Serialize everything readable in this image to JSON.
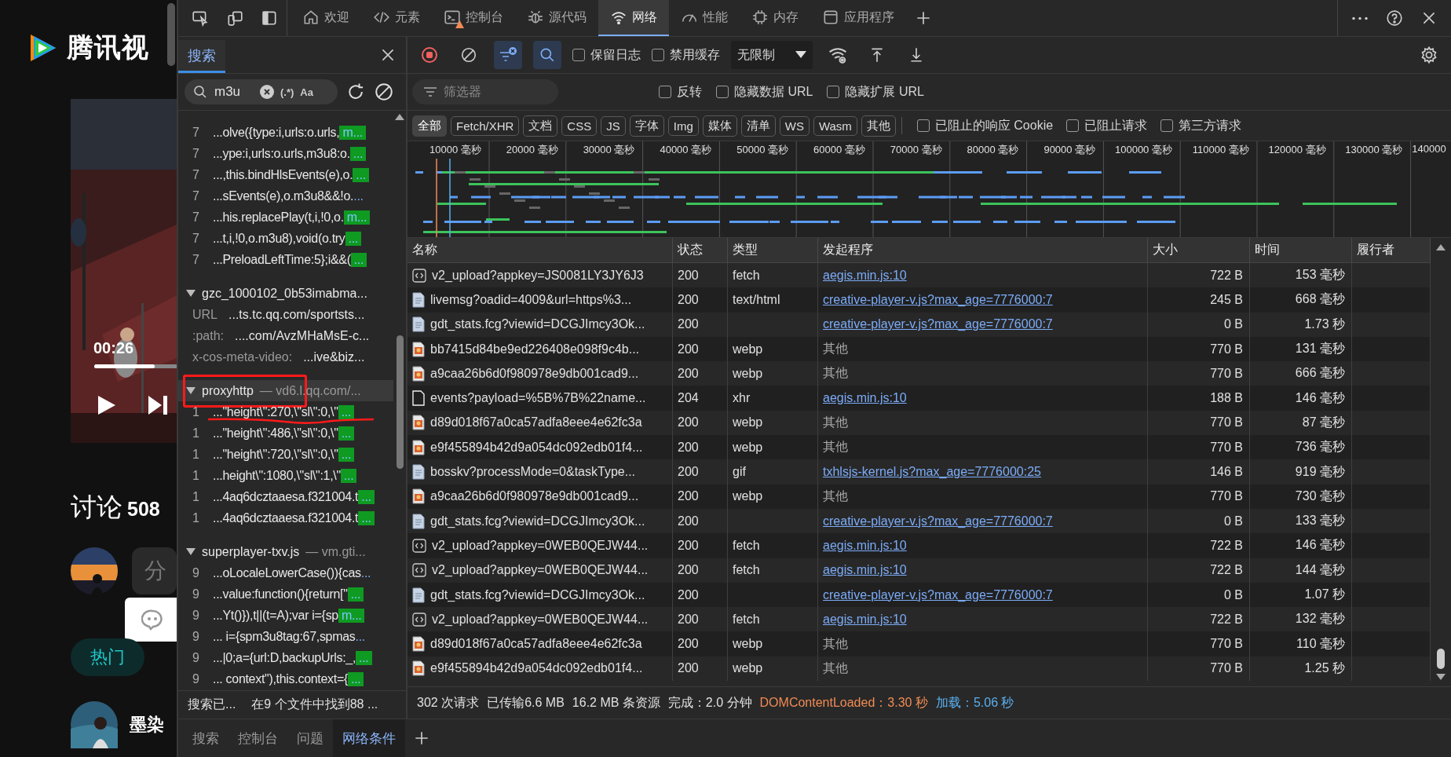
{
  "webpage": {
    "logo_text": "腾讯视",
    "video": {
      "time": "00:26",
      "level": 0.7
    },
    "discussion": {
      "label": "讨论",
      "count": "508"
    },
    "comment_preview": "分",
    "hot_tab": "热门",
    "user_name": "墨染"
  },
  "devtools": {
    "tabs": [
      {
        "label": "欢迎",
        "selected": false,
        "warning": false
      },
      {
        "label": "元素",
        "selected": false,
        "warning": false
      },
      {
        "label": "控制台",
        "selected": false,
        "warning": true
      },
      {
        "label": "源代码",
        "selected": false,
        "warning": false
      },
      {
        "label": "网络",
        "selected": true,
        "warning": false
      },
      {
        "label": "性能",
        "selected": false,
        "warning": false
      },
      {
        "label": "内存",
        "selected": false,
        "warning": false
      },
      {
        "label": "应用程序",
        "selected": false,
        "warning": false
      }
    ]
  },
  "search_panel": {
    "tab": {
      "label": "搜索",
      "selected": true
    },
    "query": "m3u",
    "regex_toggle": "(.*)",
    "case_toggle": "Aa",
    "groups": [
      {
        "kind": "lines",
        "lines": [
          {
            "num": "7",
            "text": "...olve({type:i,urls:o.urls,",
            "match": "m...",
            "highlight": true
          },
          {
            "num": "7",
            "text": "...ype:i,urls:o.urls,m3u8:o.",
            "match": "...",
            "highlight": true
          },
          {
            "num": "7",
            "text": "...,this.bindHlsEvents(e),o.",
            "match": "...",
            "highlight": true
          },
          {
            "num": "7",
            "text": "...sEvents(e),o.m3u8&&!o.",
            "match": "...",
            "highlight": false
          },
          {
            "num": "7",
            "text": "...his.replacePlay(t,i,!0,o.",
            "match": "m...",
            "highlight": true
          },
          {
            "num": "7",
            "text": "...t,i,!0,o.m3u8),void(o.try",
            "match": "...",
            "highlight": true
          },
          {
            "num": "7",
            "text": "...PreloadLeftTime:5};i&&(",
            "match": "...",
            "highlight": true
          }
        ]
      },
      {
        "kind": "headers",
        "name": "gzc_1000102_0b53imabma...",
        "selected": false,
        "lines": [
          {
            "key": "URL",
            "value": "...ts.tc.qq.com/sportsts..."
          },
          {
            "key": ":path:",
            "value": "....com/AvzMHaMsE-c..."
          },
          {
            "key": "x-cos-meta-video:",
            "value": "...ive&biz..."
          }
        ]
      },
      {
        "kind": "lines",
        "name": "proxyhttp",
        "source": "— vd6.l.qq.com/...",
        "selected": true,
        "lines": [
          {
            "num": "1",
            "text": "...\"height\\\":270,\\\"sl\\\":0,\\\"",
            "match": "...",
            "highlight": true
          },
          {
            "num": "1",
            "text": "...\"height\\\":486,\\\"sl\\\":0,\\\"",
            "match": "...",
            "highlight": true
          },
          {
            "num": "1",
            "text": "...\"height\\\":720,\\\"sl\\\":0,\\\"",
            "match": "...",
            "highlight": true
          },
          {
            "num": "1",
            "text": "...height\\\":1080,\\\"sl\\\":1,\\\"",
            "match": "...",
            "highlight": true
          },
          {
            "num": "1",
            "text": "...4aq6dcztaaesa.f321004.t",
            "match": "...",
            "highlight": true
          },
          {
            "num": "1",
            "text": "...4aq6dcztaaesa.f321004.t",
            "match": "...",
            "highlight": true
          }
        ]
      },
      {
        "kind": "lines",
        "name": "superplayer-txv.js",
        "source": "— vm.gti...",
        "selected": false,
        "lines": [
          {
            "num": "9",
            "text": "...oLocaleLowerCase()){cas",
            "match": "...",
            "highlight": false
          },
          {
            "num": "9",
            "text": "...value:function(){return[\"",
            "match": "...",
            "highlight": true
          },
          {
            "num": "9",
            "text": "...Yt()}),t||(t=A);var i={sp",
            "match": "m...",
            "highlight": true
          },
          {
            "num": "9",
            "text": "... i={spm3u8tag:67,spmas",
            "match": "...",
            "highlight": false
          },
          {
            "num": "9",
            "text": "...|0;a={url:D,backupUrls:_,",
            "match": "...",
            "highlight": true
          },
          {
            "num": "9",
            "text": "... context\"),this.context={",
            "match": "...",
            "highlight": true
          }
        ]
      }
    ],
    "status": [
      "搜索已...",
      "在9 个文件中找到88 ..."
    ]
  },
  "network": {
    "preserve_log": {
      "label": "保留日志",
      "checked": false
    },
    "disable_cache": {
      "label": "禁用缓存",
      "checked": false
    },
    "throttle": "无限制",
    "filter": {
      "placeholder": "筛选器"
    },
    "filter_checks": [
      {
        "label": "反转",
        "checked": false
      },
      {
        "label": "隐藏数据 URL",
        "checked": false
      },
      {
        "label": "隐藏扩展 URL",
        "checked": false
      }
    ],
    "chips": [
      {
        "label": "全部",
        "selected": true
      },
      {
        "label": "Fetch/XHR",
        "selected": false
      },
      {
        "label": "文档",
        "selected": false
      },
      {
        "label": "CSS",
        "selected": false
      },
      {
        "label": "JS",
        "selected": false
      },
      {
        "label": "字体",
        "selected": false
      },
      {
        "label": "Img",
        "selected": false
      },
      {
        "label": "媒体",
        "selected": false
      },
      {
        "label": "清单",
        "selected": false
      },
      {
        "label": "WS",
        "selected": false
      },
      {
        "label": "Wasm",
        "selected": false
      },
      {
        "label": "其他",
        "selected": false
      }
    ],
    "extra_checks": [
      {
        "label": "已阻止的响应 Cookie",
        "checked": false
      },
      {
        "label": "已阻止请求",
        "checked": false
      },
      {
        "label": "第三方请求",
        "checked": false
      }
    ],
    "timeline_ticks": [
      "10000 毫秒",
      "20000 毫秒",
      "30000 毫秒",
      "40000 毫秒",
      "50000 毫秒",
      "60000 毫秒",
      "70000 毫秒",
      "80000 毫秒",
      "90000 毫秒",
      "100000 毫秒",
      "110000 毫秒",
      "120000 毫秒",
      "130000 毫秒",
      "140000"
    ],
    "table": {
      "columns": [
        "名称",
        "状态",
        "类型",
        "发起程序",
        "大小",
        "时间",
        "履行者"
      ],
      "rows": [
        {
          "kind": "script",
          "name": "v2_upload?appkey=JS0081LY3JY6J3",
          "status": "200",
          "type": "fetch",
          "initiator": {
            "text": "aegis.min.js:10",
            "kind": "link"
          },
          "size": "722 B",
          "time": "153 毫秒"
        },
        {
          "kind": "page",
          "name": "livemsg?oadid=4009&url=https%3...",
          "status": "200",
          "type": "text/html",
          "initiator": {
            "text": "creative-player-v.js?max_age=7776000:7",
            "kind": "link"
          },
          "size": "245 B",
          "time": "668 毫秒"
        },
        {
          "kind": "page",
          "name": "gdt_stats.fcg?viewid=DCGJImcy3Ok...",
          "status": "200",
          "initiator": {
            "text": "creative-player-v.js?max_age=7776000:7",
            "kind": "link"
          },
          "size": "0 B",
          "time": "1.73 秒"
        },
        {
          "kind": "picture",
          "name": "bb7415d84be9ed226408e098f9c4b...",
          "status": "200",
          "type": "webp",
          "initiator": {
            "text": "其他",
            "kind": "plain"
          },
          "size": "770 B",
          "time": "131 毫秒"
        },
        {
          "kind": "picture",
          "name": "a9caa26b6d0f980978e9db001cad9...",
          "status": "200",
          "type": "webp",
          "initiator": {
            "text": "其他",
            "kind": "plain"
          },
          "size": "770 B",
          "time": "666 毫秒"
        },
        {
          "kind": "blank",
          "name": "events?payload=%5B%7B%22name...",
          "status": "204",
          "type": "xhr",
          "initiator": {
            "text": "aegis.min.js:10",
            "kind": "link"
          },
          "size": "188 B",
          "time": "146 毫秒"
        },
        {
          "kind": "picture",
          "name": "d89d018f67a0ca57adfa8eee4e62fc3a",
          "status": "200",
          "type": "webp",
          "initiator": {
            "text": "其他",
            "kind": "plain"
          },
          "size": "770 B",
          "time": "87 毫秒"
        },
        {
          "kind": "picture",
          "name": "e9f455894b42d9a054dc092edb01f4...",
          "status": "200",
          "type": "webp",
          "initiator": {
            "text": "其他",
            "kind": "plain"
          },
          "size": "770 B",
          "time": "736 毫秒"
        },
        {
          "kind": "page",
          "name": "bosskv?processMode=0&taskType...",
          "status": "200",
          "type": "gif",
          "initiator": {
            "text": "txhlsjs-kernel.js?max_age=7776000:25",
            "kind": "link"
          },
          "size": "146 B",
          "time": "919 毫秒"
        },
        {
          "kind": "picture",
          "name": "a9caa26b6d0f980978e9db001cad9...",
          "status": "200",
          "type": "webp",
          "initiator": {
            "text": "其他",
            "kind": "plain"
          },
          "size": "770 B",
          "time": "730 毫秒"
        },
        {
          "kind": "page",
          "name": "gdt_stats.fcg?viewid=DCGJImcy3Ok...",
          "status": "200",
          "initiator": {
            "text": "creative-player-v.js?max_age=7776000:7",
            "kind": "link"
          },
          "size": "0 B",
          "time": "133 毫秒"
        },
        {
          "kind": "script",
          "name": "v2_upload?appkey=0WEB0QEJW44...",
          "status": "200",
          "type": "fetch",
          "initiator": {
            "text": "aegis.min.js:10",
            "kind": "link"
          },
          "size": "722 B",
          "time": "146 毫秒"
        },
        {
          "kind": "script",
          "name": "v2_upload?appkey=0WEB0QEJW44...",
          "status": "200",
          "type": "fetch",
          "initiator": {
            "text": "aegis.min.js:10",
            "kind": "link"
          },
          "size": "722 B",
          "time": "144 毫秒"
        },
        {
          "kind": "page",
          "name": "gdt_stats.fcg?viewid=DCGJImcy3Ok...",
          "status": "200",
          "initiator": {
            "text": "creative-player-v.js?max_age=7776000:7",
            "kind": "link"
          },
          "size": "0 B",
          "time": "1.07 秒"
        },
        {
          "kind": "script",
          "name": "v2_upload?appkey=0WEB0QEJW44...",
          "status": "200",
          "type": "fetch",
          "initiator": {
            "text": "aegis.min.js:10",
            "kind": "link"
          },
          "size": "722 B",
          "time": "132 毫秒"
        },
        {
          "kind": "picture",
          "name": "d89d018f67a0ca57adfa8eee4e62fc3a",
          "status": "200",
          "type": "webp",
          "initiator": {
            "text": "其他",
            "kind": "plain"
          },
          "size": "770 B",
          "time": "110 毫秒"
        },
        {
          "kind": "picture",
          "name": "e9f455894b42d9a054dc092edb01f4...",
          "status": "200",
          "type": "webp",
          "initiator": {
            "text": "其他",
            "kind": "plain"
          },
          "size": "770 B",
          "time": "1.25 秒"
        }
      ]
    },
    "status_bar": [
      {
        "text": "302 次请求",
        "kind": "plain"
      },
      {
        "text": "已传输6.6 MB",
        "kind": "plain"
      },
      {
        "text": "16.2 MB 条资源",
        "kind": "plain"
      },
      {
        "text": "完成：2.0 分钟",
        "kind": "plain"
      },
      {
        "text": "DOMContentLoaded：3.30 秒",
        "kind": "dom"
      },
      {
        "text": "加载：5.06 秒",
        "kind": "load"
      }
    ]
  },
  "drawer_tabs": [
    {
      "label": "搜索",
      "selected": false
    },
    {
      "label": "控制台",
      "selected": false
    },
    {
      "label": "问题",
      "selected": false
    },
    {
      "label": "网络条件",
      "selected": true
    }
  ]
}
